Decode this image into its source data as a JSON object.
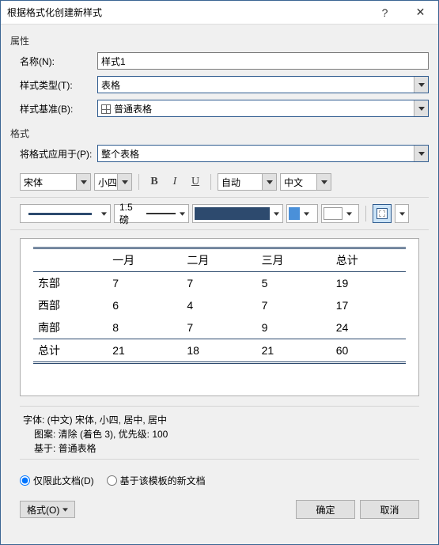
{
  "titlebar": {
    "title": "根据格式化创建新样式",
    "help": "?",
    "close": "✕"
  },
  "sections": {
    "properties": "属性",
    "format": "格式"
  },
  "fields": {
    "name_label": "名称(N):",
    "name_value": "样式1",
    "type_label": "样式类型(T):",
    "type_value": "表格",
    "based_label": "样式基准(B):",
    "based_value": "普通表格",
    "apply_label": "将格式应用于(P):",
    "apply_value": "整个表格"
  },
  "toolbar": {
    "font": "宋体",
    "size": "小四",
    "bold": "B",
    "italic": "I",
    "underline": "U",
    "fontcolor": "自动",
    "lang": "中文",
    "weight": "1.5 磅"
  },
  "chart_data": {
    "type": "table",
    "headers": [
      "",
      "一月",
      "二月",
      "三月",
      "总计"
    ],
    "rows": [
      [
        "东部",
        7,
        7,
        5,
        19
      ],
      [
        "西部",
        6,
        4,
        7,
        17
      ],
      [
        "南部",
        8,
        7,
        9,
        24
      ],
      [
        "总计",
        21,
        18,
        21,
        60
      ]
    ]
  },
  "description": {
    "line1": "字体: (中文) 宋体, 小四, 居中, 居中",
    "line2": "图案: 清除 (着色 3), 优先级: 100",
    "line3": "基于: 普通表格"
  },
  "radios": {
    "doc_only": "仅限此文档(D)",
    "template": "基于该模板的新文档"
  },
  "footer": {
    "format": "格式(O)",
    "ok": "确定",
    "cancel": "取消"
  }
}
